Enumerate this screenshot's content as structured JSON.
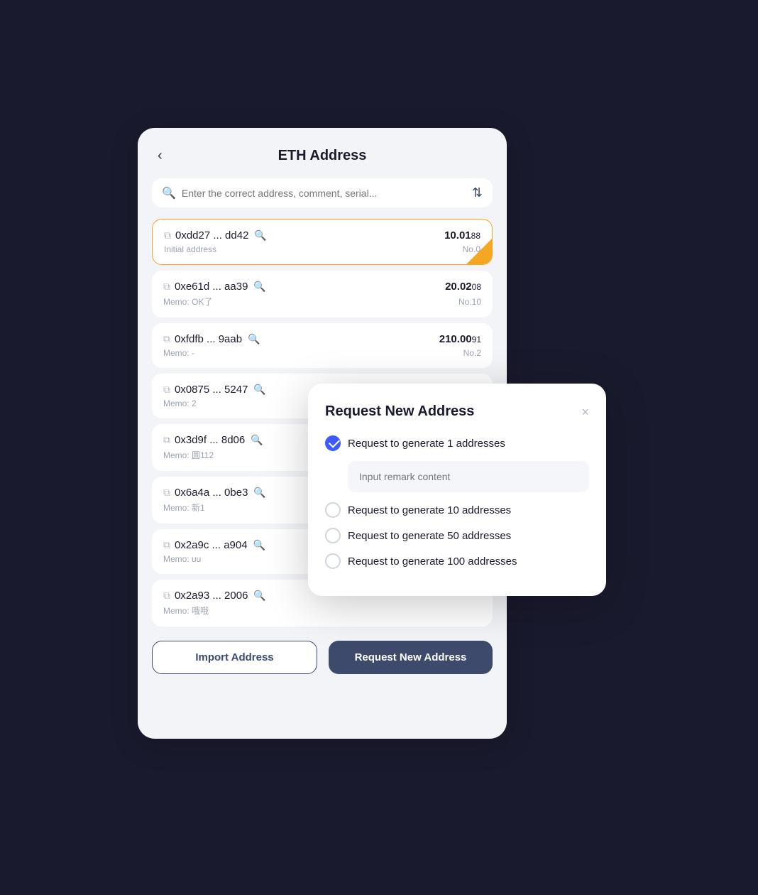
{
  "header": {
    "title": "ETH Address",
    "back_label": "‹"
  },
  "search": {
    "placeholder": "Enter the correct address, comment, serial..."
  },
  "addresses": [
    {
      "address": "0xdd27 ... dd42",
      "memo": "Initial address",
      "amount_main": "10.01",
      "amount_small": "88",
      "no": "No.0",
      "active": true
    },
    {
      "address": "0xe61d ... aa39",
      "memo": "Memo: OK了",
      "amount_main": "20.02",
      "amount_small": "08",
      "no": "No.10",
      "active": false
    },
    {
      "address": "0xfdfb ... 9aab",
      "memo": "Memo: -",
      "amount_main": "210.00",
      "amount_small": "91",
      "no": "No.2",
      "active": false
    },
    {
      "address": "0x0875 ... 5247",
      "memo": "Memo: 2",
      "amount_main": "",
      "amount_small": "",
      "no": "",
      "active": false
    },
    {
      "address": "0x3d9f ... 8d06",
      "memo": "Memo: 圆112",
      "amount_main": "",
      "amount_small": "",
      "no": "",
      "active": false
    },
    {
      "address": "0x6a4a ... 0be3",
      "memo": "Memo: 新1",
      "amount_main": "",
      "amount_small": "",
      "no": "",
      "active": false
    },
    {
      "address": "0x2a9c ... a904",
      "memo": "Memo: uu",
      "amount_main": "",
      "amount_small": "",
      "no": "",
      "active": false
    },
    {
      "address": "0x2a93 ... 2006",
      "memo": "Memo: 哦哦",
      "amount_main": "",
      "amount_small": "",
      "no": "",
      "active": false
    }
  ],
  "footer": {
    "import_label": "Import Address",
    "request_label": "Request New Address"
  },
  "modal": {
    "title": "Request New Address",
    "close_label": "×",
    "remark_placeholder": "Input remark content",
    "options": [
      {
        "label": "Request to generate 1 addresses",
        "checked": true
      },
      {
        "label": "Request to generate 10 addresses",
        "checked": false
      },
      {
        "label": "Request to generate 50 addresses",
        "checked": false
      },
      {
        "label": "Request to generate 100 addresses",
        "checked": false
      }
    ]
  }
}
